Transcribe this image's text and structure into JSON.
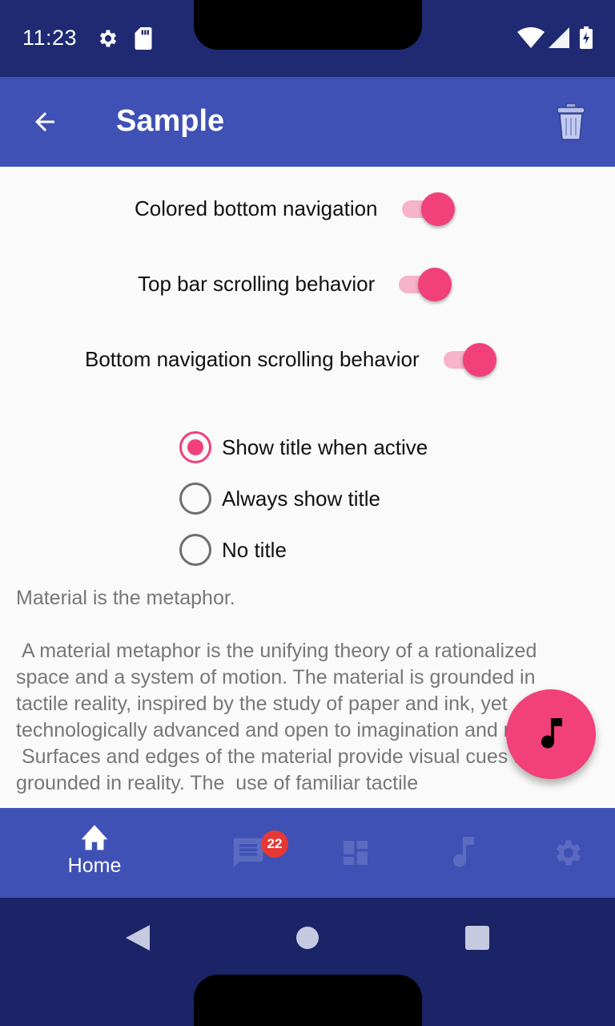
{
  "status_bar": {
    "time": "11:23",
    "icons": [
      "gear-icon",
      "sd-card-icon",
      "wifi-icon",
      "signal-icon",
      "battery-charging-icon"
    ]
  },
  "app_bar": {
    "title": "Sample",
    "back_icon": "arrow-back-icon",
    "action_icon": "trash-icon"
  },
  "settings": {
    "switches": [
      {
        "label": "Colored bottom navigation",
        "on": true
      },
      {
        "label": "Top bar scrolling behavior",
        "on": true
      },
      {
        "label": "Bottom navigation scrolling behavior",
        "on": true
      }
    ],
    "radio_options": [
      {
        "label": "Show title when active",
        "checked": true
      },
      {
        "label": "Always show title",
        "checked": false
      },
      {
        "label": "No title",
        "checked": false
      }
    ]
  },
  "body_text": "Material is the metaphor.\n\n A material metaphor is the unifying theory of a rationalized space and a system of motion. The material is grounded in tactile reality, inspired by the study of paper and ink, yet  technologically advanced and open to imagination and magic.\n Surfaces and edges of the material provide visual cues that are grounded in reality. The  use of familiar tactile",
  "fab": {
    "icon": "music-note-icon"
  },
  "bottom_nav": {
    "items": [
      {
        "icon": "home-icon",
        "label": "Home",
        "active": true
      },
      {
        "icon": "message-icon",
        "badge": "22",
        "active": false
      },
      {
        "icon": "dashboard-icon",
        "active": false
      },
      {
        "icon": "music-note-icon",
        "active": false
      },
      {
        "icon": "settings-icon",
        "active": false
      }
    ]
  },
  "colors": {
    "primary": "#3f51b5",
    "primary_dark": "#1f2a72",
    "accent": "#f1407a",
    "badge": "#e53935"
  }
}
